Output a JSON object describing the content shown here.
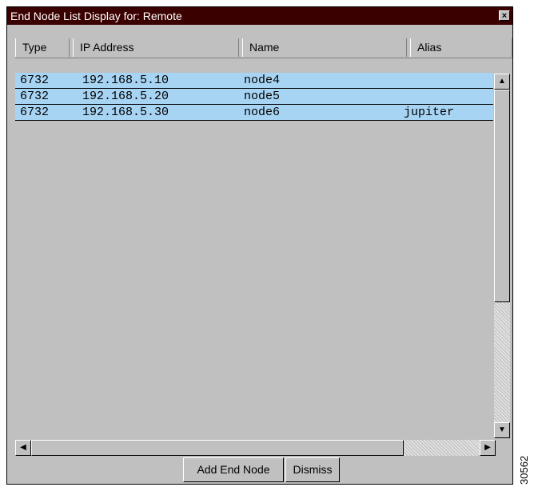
{
  "window": {
    "title": "End Node List Display for: Remote",
    "close_glyph": "×"
  },
  "columns": [
    "Type",
    "IP Address",
    "Name",
    "Alias"
  ],
  "rows": [
    {
      "type": "6732",
      "ip": "192.168.5.10",
      "name": "node4",
      "alias": ""
    },
    {
      "type": "6732",
      "ip": "192.168.5.20",
      "name": "node5",
      "alias": ""
    },
    {
      "type": "6732",
      "ip": "192.168.5.30",
      "name": "node6",
      "alias": "jupiter"
    }
  ],
  "scroll": {
    "up": "▲",
    "down": "▼",
    "left": "◀",
    "right": "▶"
  },
  "buttons": {
    "add": "Add End Node",
    "dismiss": "Dismiss"
  },
  "figure_id": "30562",
  "colors": {
    "title_bg": "#3a0000",
    "row_bg": "#a8d4f4",
    "window_bg": "#c0c0c0"
  }
}
